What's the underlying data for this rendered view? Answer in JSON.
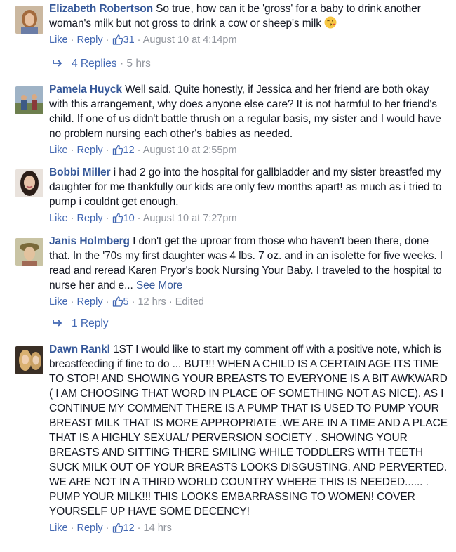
{
  "comments": [
    {
      "author": "Elizabeth Robertson",
      "text": "So true, how can it be 'gross' for a baby to drink another woman's milk but not gross to drink a cow or sheep's milk",
      "emoji": "kissing-face-emoji",
      "like": "Like",
      "reply": "Reply",
      "likes": "31",
      "time": "August 10 at 4:14pm"
    },
    {
      "author": "Pamela Huyck",
      "text": "Well said. Quite honestly, if Jessica and her friend are both okay with this arrangement, why does anyone else care? It is not harmful to her friend's child. If one of us didn't battle thrush on a regular basis, my sister and I would have no problem nursing each other's babies as needed.",
      "like": "Like",
      "reply": "Reply",
      "likes": "12",
      "time": "August 10 at 2:55pm"
    },
    {
      "author": "Bobbi Miller",
      "text": "i had 2 go into the hospital for gallbladder and my sister breastfed my daughter for me thankfully our kids are only few months apart! as much as i tried to pump i couldnt get enough.",
      "like": "Like",
      "reply": "Reply",
      "likes": "10",
      "time": "August 10 at 7:27pm"
    },
    {
      "author": "Janis Holmberg",
      "text": "I don't get the uproar from those who haven't been there, done that. In the '70s my first daughter was 4 lbs. 7 oz. and in an isolette for five weeks. I read and reread Karen Pryor's book Nursing Your Baby. I traveled to the hospital to nurse her and e...",
      "see_more": "See More",
      "like": "Like",
      "reply": "Reply",
      "likes": "5",
      "time": "12 hrs",
      "edited": "Edited"
    },
    {
      "author": "Dawn Rankl",
      "text": "1ST I would like to start my comment off with a positive note, which is breastfeeding if fine to do ... BUT!!! WHEN A CHILD IS A CERTAIN AGE ITS TIME TO STOP! AND SHOWING YOUR BREASTS TO EVERYONE IS A BIT AWKWARD ( I AM CHOOSING THAT WORD IN PLACE OF SOMETHING NOT AS NICE). AS I CONTINUE MY COMMENT THERE IS A PUMP THAT IS USED TO PUMP YOUR BREAST MILK THAT IS MORE APPROPRIATE .WE ARE IN A TIME AND A PLACE THAT IS A HIGHLY SEXUAL/ PERVERSION SOCIETY . SHOWING YOUR BREASTS AND SITTING THERE SMILING WHILE TODDLERS WITH TEETH SUCK MILK OUT OF YOUR BREASTS LOOKS DISGUSTING. AND PERVERTED. WE ARE NOT IN A THIRD WORLD COUNTRY WHERE THIS IS NEEDED...... . PUMP YOUR MILK!!! THIS LOOKS EMBARRASSING TO WOMEN! COVER YOURSELF UP HAVE SOME DECENCY!",
      "like": "Like",
      "reply": "Reply",
      "likes": "12",
      "time": "14 hrs"
    }
  ],
  "replies": [
    {
      "label": "4 Replies",
      "time": "5 hrs"
    },
    {
      "label": "1 Reply"
    }
  ],
  "separator": "·",
  "colors": {
    "link": "#365899",
    "action": "#4267b2",
    "meta": "#90949c",
    "text": "#141823"
  }
}
